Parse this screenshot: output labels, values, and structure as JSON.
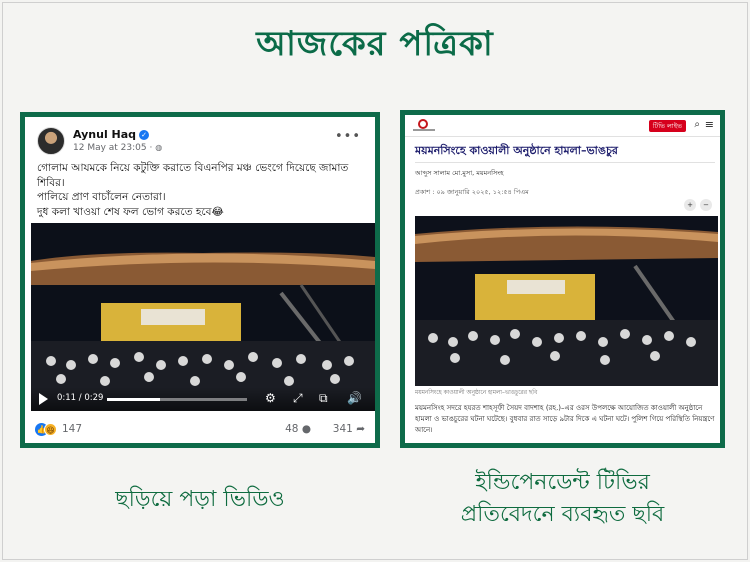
{
  "masthead": {
    "title": "আজকের পত্রিকা"
  },
  "left_post": {
    "author": "Aynul Haq",
    "time": "12 May at 23:05 · ",
    "more": "•••",
    "text_lines": [
      "গোলাম আযমকে নিয়ে কটুক্তি করাতে বিএনপির মঞ্চ ভেংগে দিয়েছে জামাত শিবির।",
      "পালিয়ে প্রাণ বাচাঁলেন নেতারা।",
      "দুধ কলা খাওয়া শেষ ফল ভোগ করতে হবে😂"
    ],
    "video": {
      "time": "0:11 / 0:29",
      "progress": 0.38
    },
    "reactions_count": "147",
    "comments_count": "48",
    "shares_count": "341"
  },
  "right_article": {
    "live_label": "টিভি লাইভ",
    "headline": "ময়মনসিংহে কাওয়ালী অনুষ্ঠানে হামলা–ভাঙচুর",
    "author": "আব্দুস সালাম মো.মুসা, ময়মনসিংহ",
    "date": "প্রকাশ : ০৯ জানুয়ারি ২০২৫, ১২:৫৪ পিএম",
    "zoom_in": "+",
    "zoom_out": "−",
    "caption": "ময়মনসিংহে কাওয়ালী অনুষ্ঠানে হামলা–ভাঙচুরের ছবি",
    "body": "ময়মনসিংহ সদরে হযরত শাহসূফী সৈয়দ বাদশাহ (রহ.)–এর ওরস উপলক্ষে আয়োজিত কাওয়ালী অনুষ্ঠানে হামলা ও ভাঙচুরের ঘটনা ঘটেছে। বুধবার রাত সাড়ে ৯টার দিকে এ ঘটনা ঘটে। পুলিশ গিয়ে পরিস্থিতি নিয়ন্ত্রণে আনে।"
  },
  "labels": {
    "left": "ছড়িয়ে পড়া ভিডিও",
    "right_line1": "ইন্ডিপেনডেন্ট টিভির",
    "right_line2": "প্রতিবেদনে ব্যবহৃত ছবি"
  },
  "colors": {
    "brand_green": "#0e6b4a",
    "itv_red": "#d6001c",
    "fb_blue": "#1877f2"
  },
  "icons": [
    "verified-icon",
    "globe-icon",
    "play-icon",
    "settings-icon",
    "fullscreen-icon",
    "volume-icon",
    "like-icon",
    "comment-icon",
    "share-icon",
    "search-icon",
    "menu-icon"
  ]
}
